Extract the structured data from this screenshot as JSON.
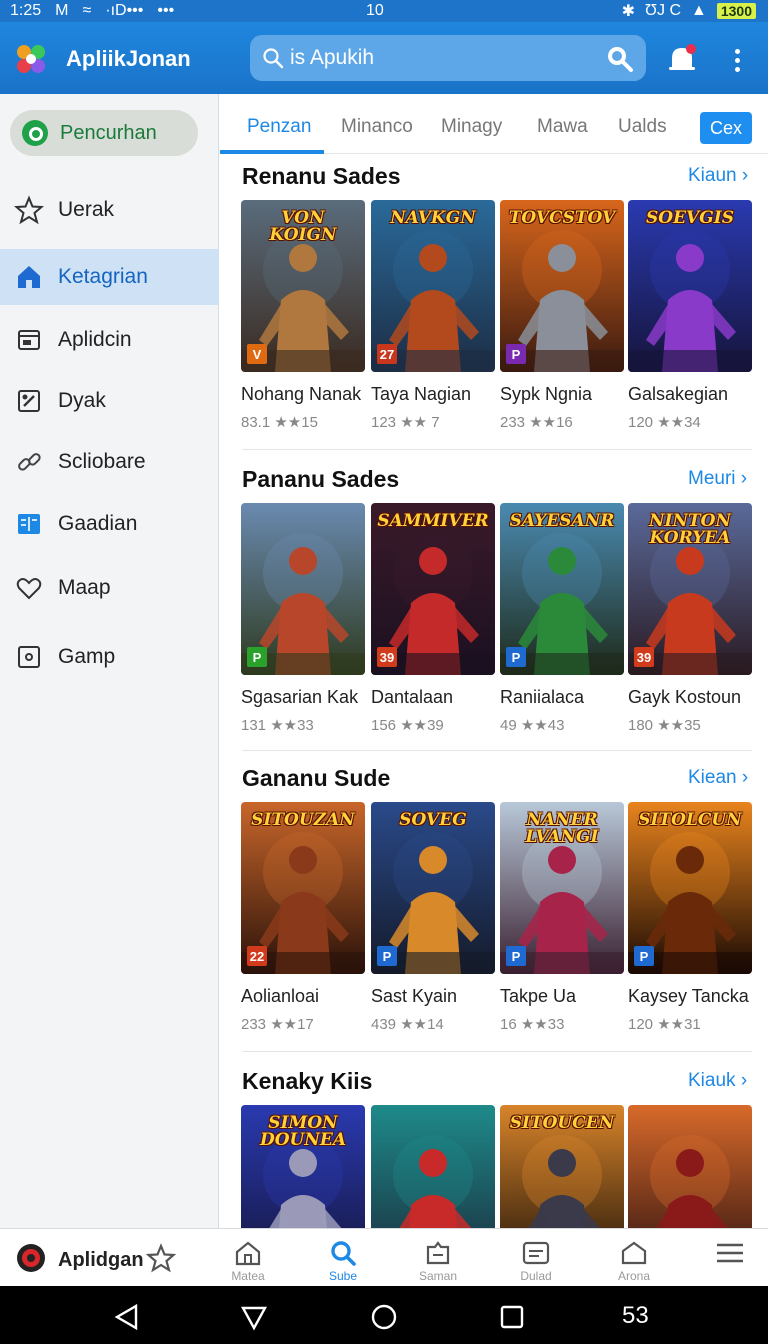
{
  "status_bar": {
    "time": "1:25",
    "carrier": "M",
    "dots": "·ıD•••",
    "more": "•••",
    "center": "10",
    "right_text": "ƱJ C",
    "battery": "1300"
  },
  "app_bar": {
    "title": "ApliikJonan",
    "search_placeholder": "is Apukih"
  },
  "sidebar": {
    "search_chip": "Pencurhan",
    "items": [
      {
        "label": "Uerak",
        "icon": "star-icon"
      },
      {
        "label": "Ketagrian",
        "icon": "home-icon",
        "active": true
      },
      {
        "label": "Aplidcin",
        "icon": "app-window-icon"
      },
      {
        "label": "Dyak",
        "icon": "tool-icon"
      },
      {
        "label": "Scliobare",
        "icon": "link-icon"
      },
      {
        "label": "Gaadian",
        "icon": "book-icon"
      },
      {
        "label": "Maap",
        "icon": "heart-icon"
      },
      {
        "label": "Gamp",
        "icon": "square-icon"
      }
    ]
  },
  "tabs": {
    "items": [
      "Penzan",
      "Minanco",
      "Minagy",
      "Mawa",
      "Ualds"
    ],
    "button": "Cex"
  },
  "sections": [
    {
      "title": "Renanu Sades",
      "link": "Kiaun",
      "cards": [
        {
          "name": "Nohang Nanak",
          "rating": "83.1 ★★15",
          "art_title": "VON KOIGN",
          "badge": "V",
          "badge_color": "#e06a12",
          "palette": [
            "#5a6c7c",
            "#b0783e",
            "#3a2a20"
          ]
        },
        {
          "name": "Taya Nagian",
          "rating": "123 ★★ 7",
          "art_title": "NAVKGN",
          "badge": "27",
          "badge_color": "#c8361c",
          "palette": [
            "#2a6a9a",
            "#b24a1e",
            "#1c2d44"
          ]
        },
        {
          "name": "Sypk Ngnia",
          "rating": "233 ★★16",
          "art_title": "TOVCSTOV",
          "badge": "P",
          "badge_color": "#7a2ab0",
          "palette": [
            "#d8661c",
            "#8a8f99",
            "#3a1a10"
          ]
        },
        {
          "name": "Galsakegian",
          "rating": "120 ★★34",
          "art_title": "SOEVGIS",
          "badge": "",
          "badge_color": "#3a64c8",
          "palette": [
            "#2a3ab0",
            "#8a3ac8",
            "#16143a"
          ]
        }
      ]
    },
    {
      "title": "Pananu Sades",
      "link": "Meuri",
      "cards": [
        {
          "name": "Sgasarian Kak",
          "rating": "131 ★★33",
          "art_title": "",
          "badge": "P",
          "badge_color": "#2aa12a",
          "palette": [
            "#6a8ab0",
            "#b8462a",
            "#2e3a1e"
          ]
        },
        {
          "name": "Dantalaan",
          "rating": "156 ★★39",
          "art_title": "SAMMIVER",
          "badge": "39",
          "badge_color": "#d23a1c",
          "palette": [
            "#3a1a2a",
            "#c42a2a",
            "#1a1020"
          ]
        },
        {
          "name": "Raniialaca",
          "rating": "49 ★★43",
          "art_title": "SAYESANR",
          "badge": "P",
          "badge_color": "#1e6ad0",
          "palette": [
            "#4a8ab0",
            "#2a8a3a",
            "#1e2a1a"
          ]
        },
        {
          "name": "Gayk Kostoun",
          "rating": "180 ★★35",
          "art_title": "NINTON KORYEA",
          "badge": "39",
          "badge_color": "#d23a1c",
          "palette": [
            "#5a6a9a",
            "#c83a1e",
            "#2a1a22"
          ]
        }
      ]
    },
    {
      "title": "Gananu Sude",
      "link": "Kiean",
      "cards": [
        {
          "name": "Aolianloai",
          "rating": "233 ★★17",
          "art_title": "SITOUZAN",
          "badge": "22",
          "badge_color": "#d23a1c",
          "palette": [
            "#c8662a",
            "#8a3a1a",
            "#2a120a"
          ]
        },
        {
          "name": "Sast Kyain",
          "rating": "439 ★★14",
          "art_title": "SOVEG",
          "badge": "P",
          "badge_color": "#1e6ad0",
          "palette": [
            "#2a4a8a",
            "#d88a2a",
            "#141a2a"
          ]
        },
        {
          "name": "Takpe Ua",
          "rating": "16 ★★33",
          "art_title": "NANER LVANGI",
          "badge": "P",
          "badge_color": "#1e6ad0",
          "palette": [
            "#b8c8d8",
            "#a8234a",
            "#3a2030"
          ]
        },
        {
          "name": "Kaysey Tancka",
          "rating": "120 ★★31",
          "art_title": "SITOLCUN",
          "badge": "P",
          "badge_color": "#1e6ad0",
          "palette": [
            "#e8841e",
            "#6a2a0a",
            "#1a0a04"
          ]
        }
      ]
    },
    {
      "title": "Kenaky Kiis",
      "link": "Kiauk",
      "cards": [
        {
          "name": "",
          "rating": "",
          "art_title": "SIMON DOUNEA",
          "badge": "",
          "badge_color": "#1e6ad0",
          "palette": [
            "#2a3ab0",
            "#9a9ab8",
            "#14143a"
          ]
        },
        {
          "name": "",
          "rating": "",
          "art_title": "",
          "badge": "",
          "badge_color": "#1e6ad0",
          "palette": [
            "#1e8a8a",
            "#c82a2a",
            "#1a2a3a"
          ]
        },
        {
          "name": "",
          "rating": "",
          "art_title": "SITOUCEN",
          "badge": "",
          "badge_color": "#1e6ad0",
          "palette": [
            "#d8842a",
            "#3a3a4a",
            "#1a1008"
          ]
        },
        {
          "name": "",
          "rating": "",
          "art_title": "",
          "badge": "",
          "badge_color": "#1e6ad0",
          "palette": [
            "#d86a2a",
            "#8a1a1a",
            "#2a1010"
          ]
        }
      ]
    }
  ],
  "bottom_nav": {
    "app_name": "Aplidgan",
    "items": [
      {
        "label": "Matea",
        "icon": "home-outline-icon"
      },
      {
        "label": "Sube",
        "icon": "search-icon",
        "active": true
      },
      {
        "label": "Saman",
        "icon": "tag-icon"
      },
      {
        "label": "Dulad",
        "icon": "card-icon"
      },
      {
        "label": "Arona",
        "icon": "house-icon"
      },
      {
        "label": "",
        "icon": "menu-icon"
      }
    ]
  },
  "system_nav": {
    "extra": "53"
  },
  "colors": {
    "primary": "#1a73c8",
    "accent": "#1e88e5",
    "active_nav_bg": "#cfe2f5",
    "chip_green": "#1fa14a"
  }
}
